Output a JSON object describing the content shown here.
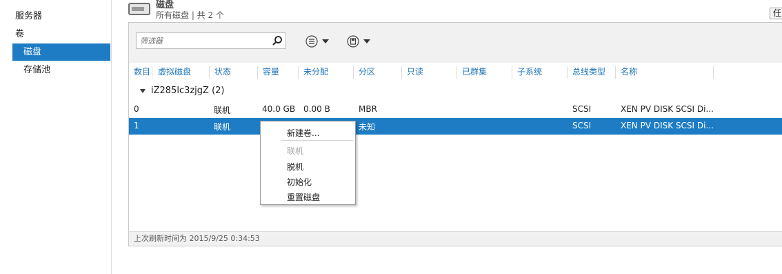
{
  "nav": {
    "servers": "服务器",
    "volumes": "卷",
    "disks": "磁盘",
    "storage_pools": "存储池"
  },
  "header": {
    "title": "磁盘",
    "subtitle": "所有磁盘 | 共 2 个",
    "task_button": "任"
  },
  "toolbar": {
    "filter_placeholder": "筛选器"
  },
  "columns": [
    "数目",
    "虚拟磁盘",
    "状态",
    "容量",
    "未分配",
    "分区",
    "只读",
    "已群集",
    "子系统",
    "总线类型",
    "名称"
  ],
  "group": {
    "label": "iZ285lc3zjgZ (2)"
  },
  "rows": [
    {
      "number": "0",
      "virtual_disk": "",
      "status": "联机",
      "capacity": "40.0 GB",
      "unallocated": "0.00 B",
      "partition": "MBR",
      "read_only": "",
      "clustered": "",
      "subsystem": "",
      "bus_type": "SCSI",
      "name": "XEN PV DISK SCSI Di..."
    },
    {
      "number": "1",
      "virtual_disk": "",
      "status": "联机",
      "capacity": "",
      "unallocated": "",
      "partition": "未知",
      "read_only": "",
      "clustered": "",
      "subsystem": "",
      "bus_type": "SCSI",
      "name": "XEN PV DISK SCSI Di..."
    }
  ],
  "status_bar": "上次刷新时间为 2015/9/25 0:34:53",
  "context_menu": {
    "new_volume": "新建卷...",
    "online": "联机",
    "offline": "脱机",
    "initialize": "初始化",
    "reset_disk": "重置磁盘"
  },
  "colors": {
    "accent": "#1d7cc4",
    "header_text": "#1d74b8",
    "toolbar_bg": "#f1f1f1"
  }
}
